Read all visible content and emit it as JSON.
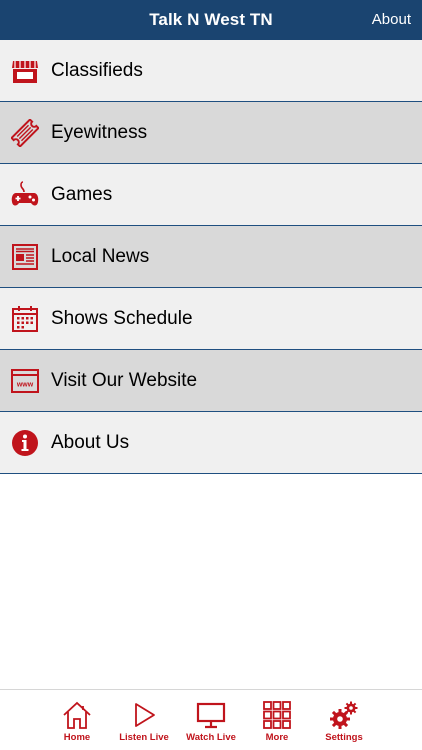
{
  "header": {
    "title": "Talk N West TN",
    "about_label": "About"
  },
  "menu": [
    {
      "label": "Classifieds",
      "icon": "store-icon"
    },
    {
      "label": "Eyewitness",
      "icon": "ticket-icon"
    },
    {
      "label": "Games",
      "icon": "gamepad-icon"
    },
    {
      "label": "Local News",
      "icon": "newspaper-icon"
    },
    {
      "label": "Shows Schedule",
      "icon": "calendar-icon"
    },
    {
      "label": "Visit Our Website",
      "icon": "browser-www-icon"
    },
    {
      "label": "About Us",
      "icon": "info-icon"
    }
  ],
  "www_icon_text": "www",
  "tabs": [
    {
      "label": "Home",
      "icon": "home-icon"
    },
    {
      "label": "Listen Live",
      "icon": "play-icon"
    },
    {
      "label": "Watch Live",
      "icon": "tv-icon"
    },
    {
      "label": "More",
      "icon": "grid-icon"
    },
    {
      "label": "Settings",
      "icon": "gears-icon"
    }
  ],
  "colors": {
    "navbar": "#1a4470",
    "accent_red": "#c0141c",
    "row_light": "#f0f0f0",
    "row_dark": "#d9d9d9",
    "row_divider": "#1f4f80"
  }
}
